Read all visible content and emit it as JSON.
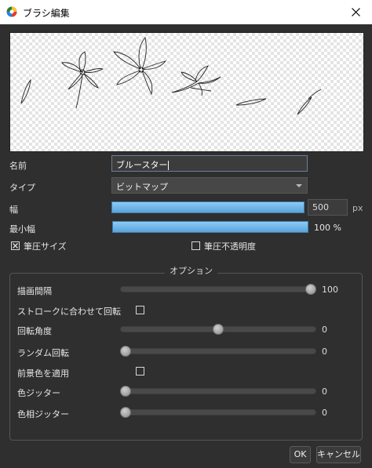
{
  "window": {
    "title": "ブラシ編集"
  },
  "form": {
    "name_label": "名前",
    "name_value": "ブルースター",
    "type_label": "タイプ",
    "type_value": "ビットマップ",
    "width_label": "幅",
    "width_value": "500",
    "width_unit": "px",
    "width_fraction": 1.0,
    "min_width_label": "最小幅",
    "min_width_value": "100 %",
    "min_width_fraction": 1.0,
    "pressure_size_label": "筆圧サイズ",
    "pressure_size_checked": true,
    "pressure_opacity_label": "筆圧不透明度",
    "pressure_opacity_checked": false
  },
  "options": {
    "group_title": "オプション",
    "spacing": {
      "label": "描画間隔",
      "value": "100",
      "fraction": 1.0
    },
    "rotate_with_stroke": {
      "label": "ストロークに合わせて回転",
      "checked": false
    },
    "rotation_angle": {
      "label": "回転角度",
      "value": "0",
      "fraction": 0.5
    },
    "random_rotation": {
      "label": "ランダム回転",
      "value": "0",
      "fraction": 0.0
    },
    "apply_fg_color": {
      "label": "前景色を適用",
      "checked": false
    },
    "color_jitter": {
      "label": "色ジッター",
      "value": "0",
      "fraction": 0.0
    },
    "hue_jitter": {
      "label": "色相ジッター",
      "value": "0",
      "fraction": 0.0
    }
  },
  "buttons": {
    "ok": "OK",
    "cancel": "キャンセル"
  },
  "icons": {
    "app": "app-logo-icon",
    "close": "close-icon",
    "dropdown": "chevron-down-icon"
  },
  "colors": {
    "accent_bar": "#6fb6ea",
    "background": "#2f2f2f"
  }
}
